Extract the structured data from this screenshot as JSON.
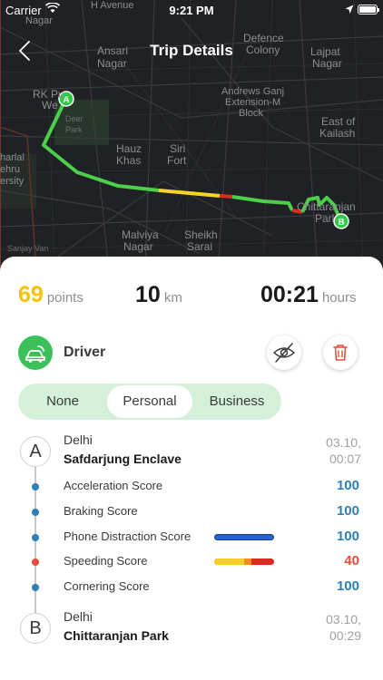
{
  "status_bar": {
    "carrier": "Carrier",
    "time": "9:21 PM"
  },
  "nav": {
    "title": "Trip Details"
  },
  "map": {
    "labels": [
      {
        "text": "H Avenue"
      },
      {
        "text": "Nagar"
      },
      {
        "text": "Ansari"
      },
      {
        "text": "Nagar"
      },
      {
        "text": "Defence"
      },
      {
        "text": "Colony"
      },
      {
        "text": "Lajpat"
      },
      {
        "text": "Nagar"
      },
      {
        "text": "RK Pu"
      },
      {
        "text": "We"
      },
      {
        "text": "Deer"
      },
      {
        "text": "Park"
      },
      {
        "text": "Andrews Ganj"
      },
      {
        "text": "Extension-M"
      },
      {
        "text": "Block"
      },
      {
        "text": "East of"
      },
      {
        "text": "Kailash"
      },
      {
        "text": "Hauz"
      },
      {
        "text": "Khas"
      },
      {
        "text": "Siri"
      },
      {
        "text": "Fort"
      },
      {
        "text": "harlal"
      },
      {
        "text": "ehru"
      },
      {
        "text": "ersity"
      },
      {
        "text": "Chittaranjan"
      },
      {
        "text": "Parl"
      },
      {
        "text": "Malviya"
      },
      {
        "text": "Nagar"
      },
      {
        "text": "Sheikh"
      },
      {
        "text": "Sarai"
      },
      {
        "text": "Sanjay Van"
      }
    ],
    "marker_start": "A",
    "marker_end": "B",
    "colors": {
      "route_green": "#4cd04a",
      "route_yellow": "#f5d52a",
      "route_red": "#e02b21"
    }
  },
  "stats": {
    "points_value": "69",
    "points_unit": "points",
    "distance_value": "10",
    "distance_unit": "km",
    "duration_value": "00:21",
    "duration_unit": "hours"
  },
  "driver": {
    "label": "Driver",
    "icon": "car-icon"
  },
  "actions": {
    "hide_icon": "eye-slash-icon",
    "delete_icon": "trash-icon"
  },
  "trip_type": {
    "options": [
      "None",
      "Personal",
      "Business"
    ],
    "selected": "Personal"
  },
  "start": {
    "letter": "A",
    "city": "Delhi",
    "place": "Safdarjung Enclave",
    "date": "03.10,",
    "time": "00:07"
  },
  "end": {
    "letter": "B",
    "city": "Delhi",
    "place": "Chittaranjan Park",
    "date": "03.10,",
    "time": "00:29"
  },
  "scores": [
    {
      "label": "Acceleration Score",
      "value": "100",
      "color": "#2c7fb8"
    },
    {
      "label": "Braking Score",
      "value": "100",
      "color": "#2c7fb8"
    },
    {
      "label": "Phone Distraction Score",
      "value": "100",
      "color": "#2c7fb8",
      "bar": "blue"
    },
    {
      "label": "Speeding Score",
      "value": "40",
      "color": "#e74c3c",
      "bar": "speed",
      "bar_segments": {
        "yellow": 0.5,
        "orange": 0.12,
        "red": 0.38
      }
    },
    {
      "label": "Cornering Score",
      "value": "100",
      "color": "#2c7fb8"
    }
  ],
  "colors": {
    "accent_green": "#3cc05a",
    "points_yellow": "#f4c20d",
    "score_blue": "#2c7fb8",
    "score_red": "#e74c3c",
    "segment_bg": "#d5f0d9"
  }
}
